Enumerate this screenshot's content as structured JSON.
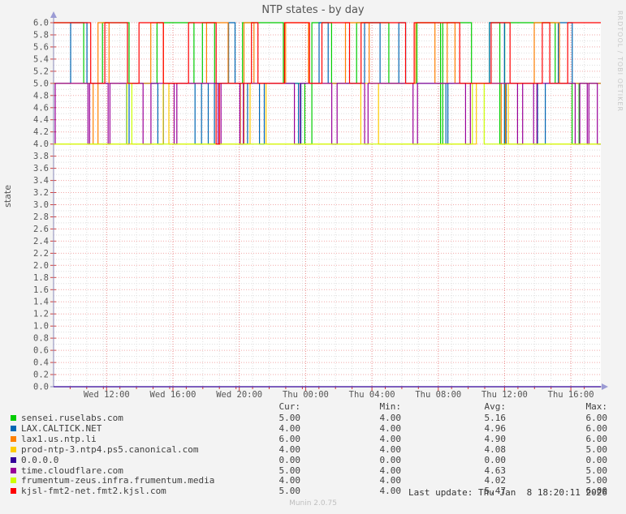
{
  "watermark": "RRDTOOL / TOBI OETIKER",
  "footer": {
    "last_update": "Last update: Thu Jan  8 18:20:11 2026",
    "version": "Munin 2.0.75"
  },
  "chart_data": {
    "type": "line",
    "title": "NTP states - by day",
    "ylabel": "state",
    "ylim": [
      0,
      6
    ],
    "y_tick_step": 0.2,
    "x_ticks": [
      "Wed 12:00",
      "Wed 16:00",
      "Wed 20:00",
      "Thu 00:00",
      "Thu 04:00",
      "Thu 08:00",
      "Thu 12:00",
      "Thu 16:00"
    ],
    "x_range_hours": 33,
    "grid": true,
    "legend_position": "bottom",
    "legend_headers": [
      "Cur:",
      "Min:",
      "Avg:",
      "Max:"
    ],
    "series": [
      {
        "name": "sensei.ruselabs.com",
        "color": "#00CC00",
        "cur": 5.0,
        "min": 4.0,
        "avg": 5.16,
        "max": 6.0,
        "levels": [
          4,
          5,
          6
        ],
        "weights": [
          6,
          44,
          50
        ],
        "seed": 11
      },
      {
        "name": "LAX.CALTICK.NET",
        "color": "#0066B3",
        "cur": 4.0,
        "min": 4.0,
        "avg": 4.96,
        "max": 6.0,
        "levels": [
          4,
          5,
          6
        ],
        "weights": [
          18,
          62,
          20
        ],
        "seed": 22
      },
      {
        "name": "lax1.us.ntp.li",
        "color": "#FF8000",
        "cur": 6.0,
        "min": 4.0,
        "avg": 4.9,
        "max": 6.0,
        "levels": [
          4,
          5,
          6
        ],
        "weights": [
          22,
          58,
          20
        ],
        "seed": 33
      },
      {
        "name": "prod-ntp-3.ntp4.ps5.canonical.com",
        "color": "#FFCC00",
        "cur": 4.0,
        "min": 4.0,
        "avg": 4.08,
        "max": 5.0,
        "levels": [
          4,
          5
        ],
        "weights": [
          92,
          8
        ],
        "seed": 44
      },
      {
        "name": "0.0.0.0",
        "color": "#330099",
        "cur": 0.0,
        "min": 0.0,
        "avg": 0.0,
        "max": 0.0,
        "levels": [
          0
        ],
        "weights": [
          100
        ],
        "seed": 55
      },
      {
        "name": "time.cloudflare.com",
        "color": "#990099",
        "cur": 5.0,
        "min": 4.0,
        "avg": 4.63,
        "max": 5.0,
        "levels": [
          4,
          5
        ],
        "weights": [
          37,
          63
        ],
        "seed": 66
      },
      {
        "name": "frumentum-zeus.infra.frumentum.media",
        "color": "#CCFF00",
        "cur": 4.0,
        "min": 4.0,
        "avg": 4.02,
        "max": 5.0,
        "levels": [
          4,
          5
        ],
        "weights": [
          97,
          3
        ],
        "seed": 77
      },
      {
        "name": "kjsl-fmt2-net.fmt2.kjsl.com",
        "color": "#FF0000",
        "cur": 5.0,
        "min": 4.0,
        "avg": 5.47,
        "max": 6.0,
        "levels": [
          4,
          5,
          6
        ],
        "weights": [
          5,
          43,
          52
        ],
        "seed": 88
      }
    ]
  }
}
